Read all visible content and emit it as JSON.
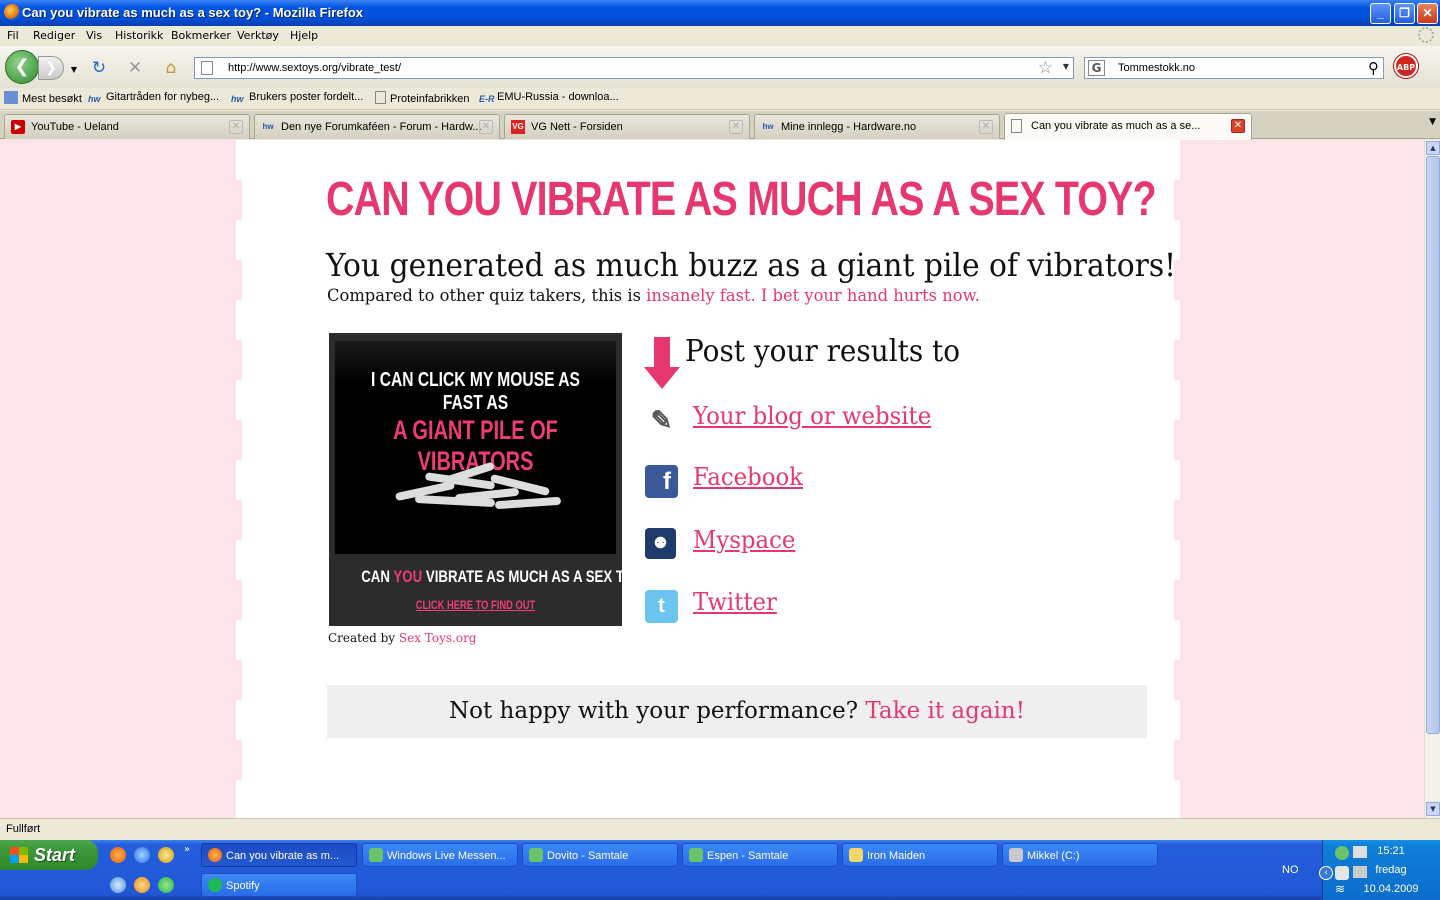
{
  "window": {
    "title": "Can you vibrate as much as a sex toy? - Mozilla Firefox"
  },
  "menu": {
    "items": [
      "Fil",
      "Rediger",
      "Vis",
      "Historikk",
      "Bokmerker",
      "Verktøy",
      "Hjelp"
    ]
  },
  "nav": {
    "url": "http://www.sextoys.org/vibrate_test/",
    "search_value": "Tommestokk.no",
    "abp_label": "ABP"
  },
  "bookmarks": [
    {
      "label": "Mest besøkt",
      "icon": "most-visited-icon"
    },
    {
      "label": "Gitartråden for nybeg...",
      "icon": "hw-icon"
    },
    {
      "label": "Brukers poster fordelt...",
      "icon": "hw-icon"
    },
    {
      "label": "Proteinfabrikken",
      "icon": "page-icon"
    },
    {
      "label": "EMU-Russia - downloa...",
      "icon": "emu-icon"
    }
  ],
  "tabs": [
    {
      "label": "YouTube - Ueland",
      "icon": "youtube-icon"
    },
    {
      "label": "Den nye Forumkaféen - Forum - Hardw...",
      "icon": "hw-icon"
    },
    {
      "label": "VG Nett - Forsiden",
      "icon": "vg-icon"
    },
    {
      "label": "Mine innlegg - Hardware.no",
      "icon": "hw-icon"
    },
    {
      "label": "Can you vibrate as much as a se...",
      "icon": "page-icon",
      "active": true
    }
  ],
  "page": {
    "headline": "CAN YOU VIBRATE AS MUCH AS A SEX TOY?",
    "result": "You generated as much buzz as a giant pile of vibrators!",
    "compare_prefix": "Compared to other quiz takers, this is",
    "compare_highlight": "insanely fast. I bet your hand hurts now.",
    "badge": {
      "line1": "I CAN CLICK MY MOUSE AS FAST AS",
      "line2": "A GIANT PILE OF VIBRATORS",
      "line3_pre": "CAN",
      "line3_pink": "YOU",
      "line3_post": "VIBRATE AS MUCH AS A SEX TOY?",
      "line4": "CLICK HERE TO FIND OUT"
    },
    "created_by_prefix": "Created by",
    "created_by_link": "Sex Toys.org",
    "post_title": "Post your results to",
    "share": [
      {
        "label": "Your blog or website",
        "icon": "blog-icon"
      },
      {
        "label": "Facebook",
        "icon": "facebook-icon"
      },
      {
        "label": "Myspace",
        "icon": "myspace-icon"
      },
      {
        "label": "Twitter",
        "icon": "twitter-icon"
      }
    ],
    "again_prefix": "Not happy with your performance?",
    "again_link": "Take it again!"
  },
  "status": {
    "text": "Fullført"
  },
  "taskbar": {
    "start_label": "Start",
    "tasks": [
      {
        "label": "Can you vibrate as m...",
        "active": true
      },
      {
        "label": "Windows Live Messen...",
        "active": false
      },
      {
        "label": "Dovito - Samtale",
        "active": false
      },
      {
        "label": "Espen - Samtale",
        "active": false
      },
      {
        "label": "Iron Maiden",
        "active": false
      },
      {
        "label": "Mikkel (C:)",
        "active": false
      },
      {
        "label": "Spotify",
        "active": false
      }
    ],
    "lang": "NO",
    "clock_time": "15:21",
    "clock_day": "fredag",
    "clock_date": "10.04.2009"
  },
  "colors": {
    "accent_pink": "#e6386e",
    "page_background": "#fde4ea"
  }
}
